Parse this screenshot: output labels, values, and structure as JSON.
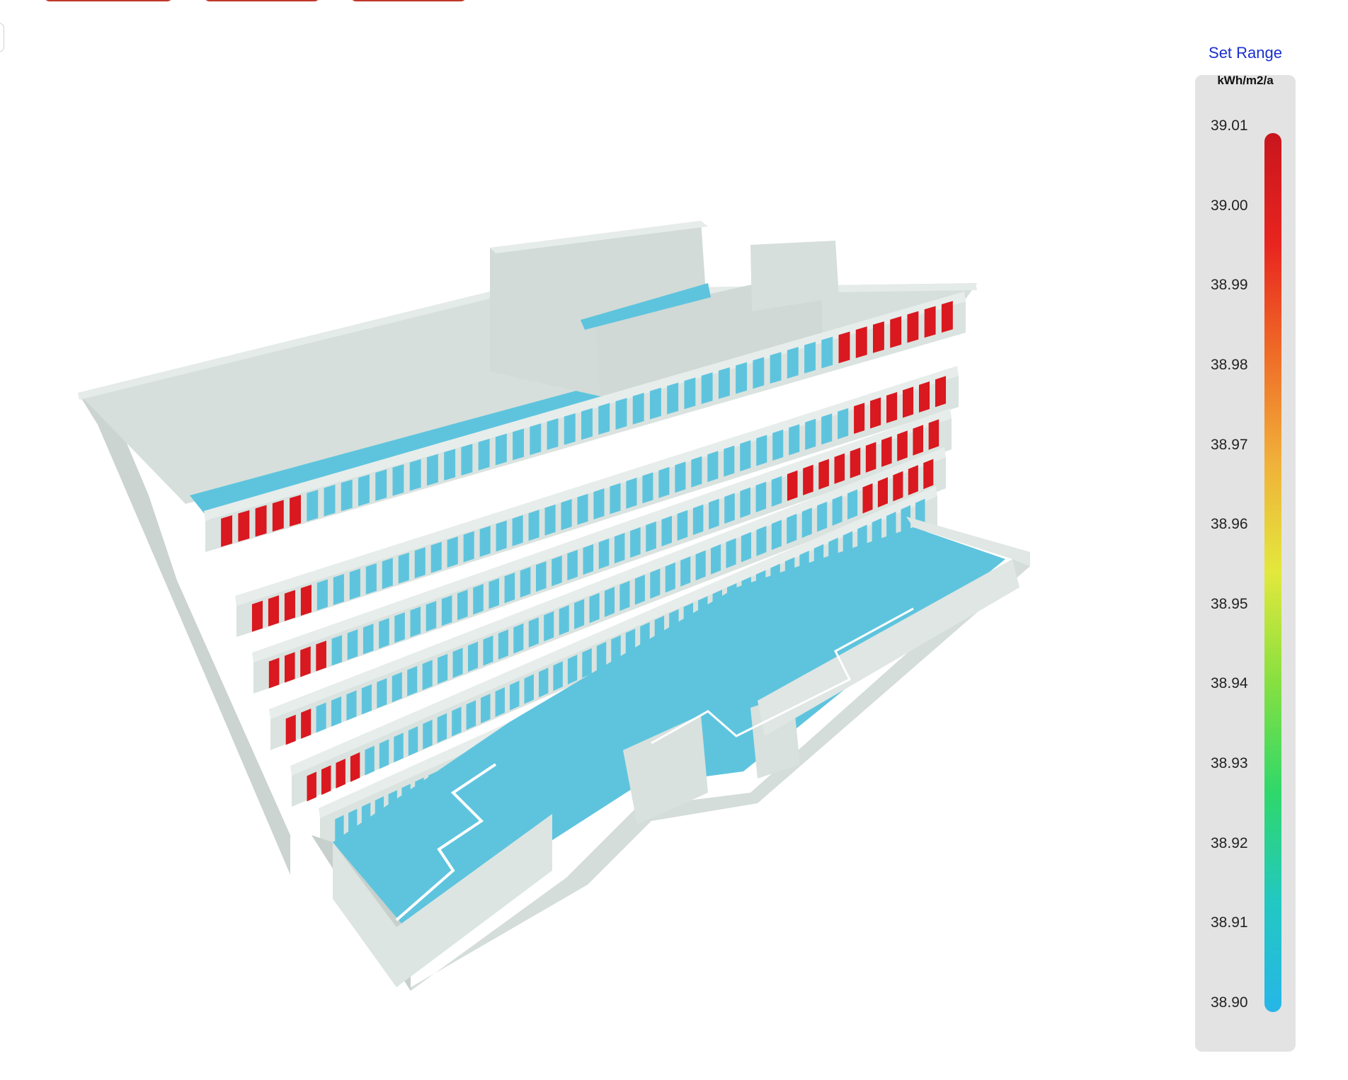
{
  "legend": {
    "set_range_label": "Set Range",
    "unit": "kWh/m2/a",
    "ticks": [
      "39.01",
      "39.00",
      "38.99",
      "38.98",
      "38.97",
      "38.96",
      "38.95",
      "38.94",
      "38.93",
      "38.92",
      "38.91",
      "38.90"
    ],
    "max": 39.01,
    "min": 38.9,
    "gradient_colors": [
      "#c8161d",
      "#e8241f",
      "#ef6b27",
      "#f0b13a",
      "#e3e83c",
      "#86e040",
      "#2fd86a",
      "#22c8c2",
      "#27b6e8"
    ]
  },
  "model": {
    "high_color": "#d9181f",
    "low_color": "#5ec4de",
    "structure_color": "#d8e2de"
  }
}
